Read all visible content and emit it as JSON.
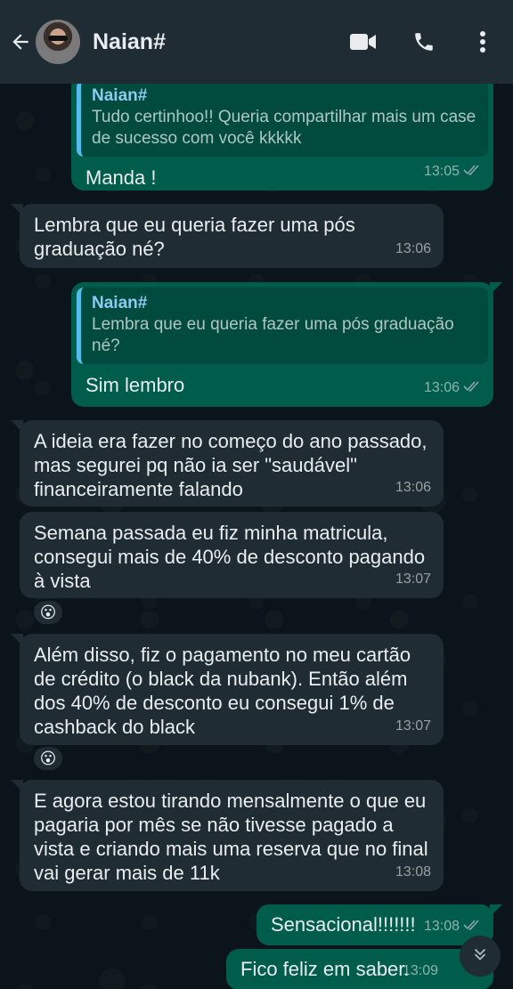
{
  "header": {
    "contact_name": "Naian#",
    "icons": [
      "back-arrow-icon",
      "video-call-icon",
      "phone-icon",
      "more-vert-icon"
    ]
  },
  "messages": [
    {
      "direction": "out",
      "quote": {
        "name": "Naian#",
        "text": "Tudo certinhoo!! Queria compartilhar mais um case de sucesso com você kkkkk"
      },
      "text": "Manda !",
      "time": "13:05",
      "status": "read"
    },
    {
      "direction": "in",
      "text": "Lembra que eu queria fazer uma pós graduação né?",
      "time": "13:06"
    },
    {
      "direction": "out",
      "quote": {
        "name": "Naian#",
        "text": "Lembra que eu queria fazer uma pós graduação né?"
      },
      "text": "Sim lembro",
      "time": "13:06",
      "status": "read"
    },
    {
      "direction": "in",
      "text": "A ideia era fazer no começo do ano passado, mas segurei pq não ia ser \"saudável\" financeiramente falando",
      "time": "13:06"
    },
    {
      "direction": "in",
      "text": "Semana passada eu fiz minha matricula, consegui mais de 40% de desconto pagando à vista",
      "time": "13:07",
      "reaction": "😮"
    },
    {
      "direction": "in",
      "text": "Além disso, fiz o pagamento no meu cartão de crédito (o black da nubank). Então além dos 40% de desconto eu consegui 1% de cashback do black",
      "time": "13:07",
      "reaction": "😮"
    },
    {
      "direction": "in",
      "text": "E agora estou tirando mensalmente o que eu pagaria por mês se não tivesse pagado a vista e criando mais uma reserva que no final vai gerar mais de 11k",
      "time": "13:08"
    },
    {
      "direction": "out",
      "text": "Sensacional!!!!!!!",
      "time": "13:08",
      "status": "read"
    },
    {
      "direction": "out",
      "text": "Fico feliz em saber.",
      "time": "13:09",
      "status": "read"
    }
  ],
  "colors": {
    "header_bg": "#1f2c34",
    "chat_bg": "#0b141a",
    "incoming_bubble": "#1f2c34",
    "outgoing_bubble": "#005c4b",
    "read_ticks": "#53bdeb"
  }
}
